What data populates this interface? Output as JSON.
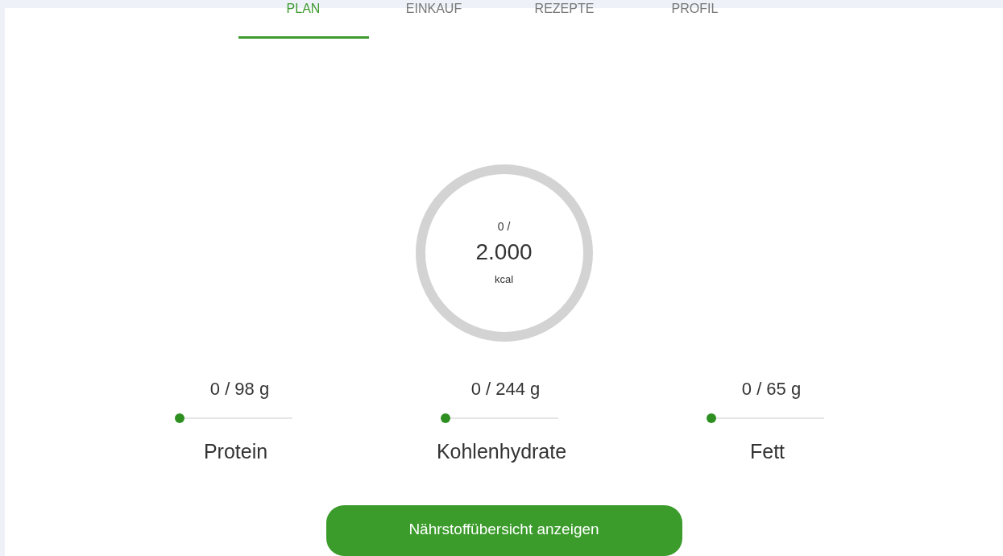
{
  "tabs": [
    {
      "label": "PLAN",
      "selected": true
    },
    {
      "label": "EINKAUF",
      "selected": false
    },
    {
      "label": "REZEPTE",
      "selected": false
    },
    {
      "label": "PROFIL",
      "selected": false
    }
  ],
  "calories": {
    "consumed": "0 /",
    "goal": "2.000",
    "unit": "kcal"
  },
  "macros": [
    {
      "reading": "0 / 98 g",
      "name": "Protein",
      "level": 0
    },
    {
      "reading": "0 / 244 g",
      "name": "Kohlenhydrate",
      "level": 0
    },
    {
      "reading": "0 / 65 g",
      "name": "Fett",
      "level": 0
    }
  ],
  "button": "Nährstoffübersicht anzeigen"
}
